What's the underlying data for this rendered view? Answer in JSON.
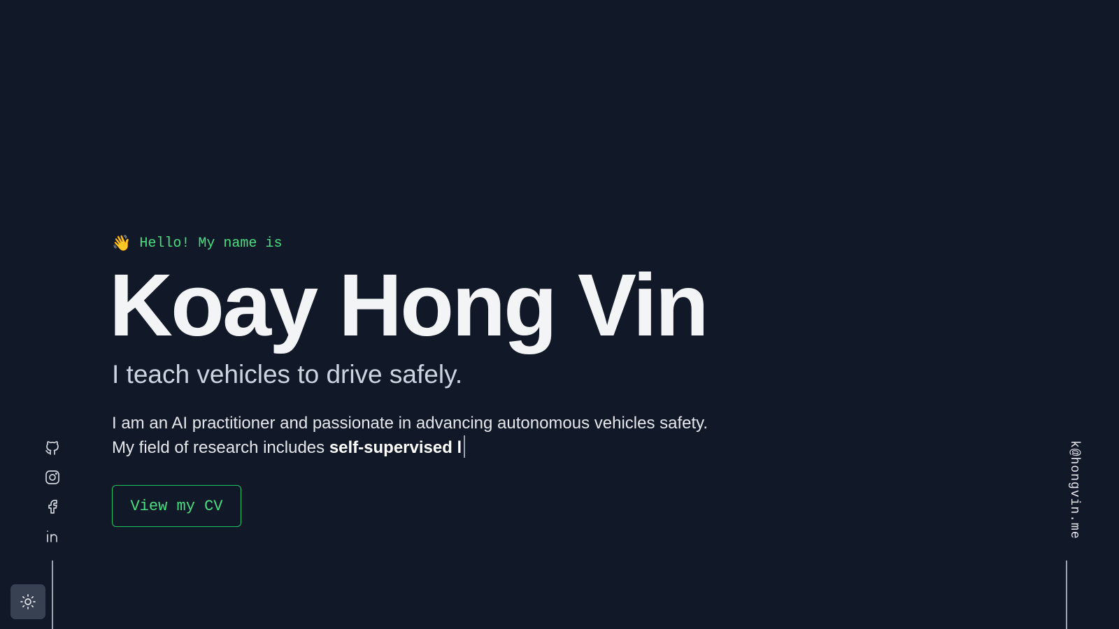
{
  "hero": {
    "wave_emoji": "👋",
    "greeting": "Hello! My name is",
    "name": "Koay Hong Vin",
    "tagline": "I teach vehicles to drive safely.",
    "bio_line1": "I am an AI practitioner and passionate in advancing autonomous vehicles safety.",
    "bio_line2_prefix": "My field of research includes ",
    "bio_line2_typed": "self-supervised l"
  },
  "cta": {
    "cv_label": "View my CV"
  },
  "social": {
    "icons": [
      "github-icon",
      "instagram-icon",
      "facebook-icon",
      "linkedin-icon"
    ]
  },
  "sidebar": {
    "email": "k@hongvin.me"
  },
  "theme_toggle": {
    "icon": "sun-icon"
  },
  "colors": {
    "background": "#111827",
    "accent": "#4ade80",
    "heading": "#f3f4f6",
    "muted": "#cbd5e1",
    "icon": "#d1d5db"
  }
}
